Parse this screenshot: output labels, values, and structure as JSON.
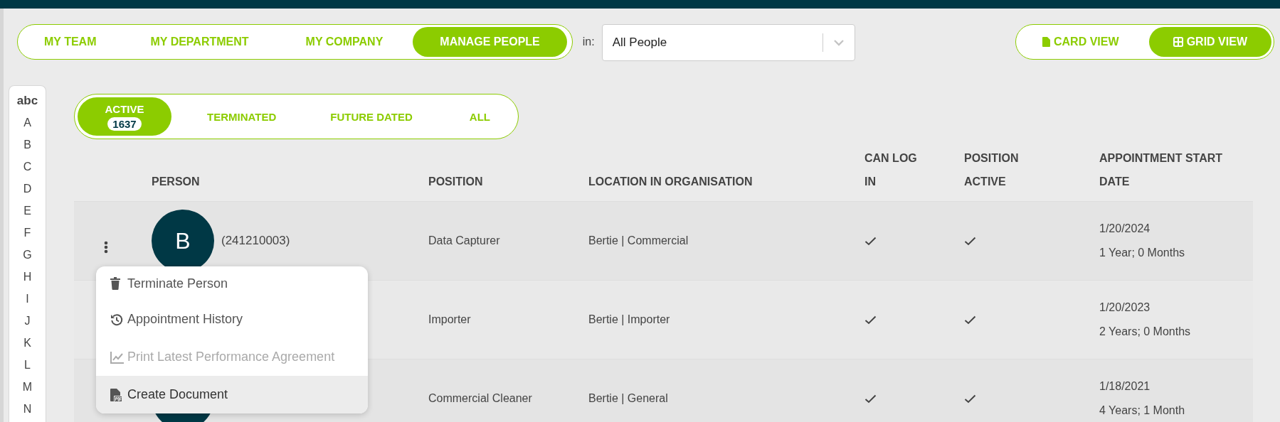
{
  "nav_tabs": [
    {
      "label": "MY TEAM",
      "selected": false
    },
    {
      "label": "MY DEPARTMENT",
      "selected": false
    },
    {
      "label": "MY COMPANY",
      "selected": false
    },
    {
      "label": "MANAGE PEOPLE",
      "selected": true
    }
  ],
  "scope": {
    "label": "in:",
    "value": "All People"
  },
  "view_toggle": [
    {
      "label": "CARD VIEW",
      "kind": "file",
      "selected": false
    },
    {
      "label": "GRID VIEW",
      "kind": "grid",
      "selected": true
    }
  ],
  "alphabet": [
    {
      "label": "abc",
      "selected": true
    },
    {
      "label": "A",
      "selected": false
    },
    {
      "label": "B",
      "selected": false
    },
    {
      "label": "C",
      "selected": false
    },
    {
      "label": "D",
      "selected": false
    },
    {
      "label": "E",
      "selected": false
    },
    {
      "label": "F",
      "selected": false
    },
    {
      "label": "G",
      "selected": false
    },
    {
      "label": "H",
      "selected": false
    },
    {
      "label": "I",
      "selected": false
    },
    {
      "label": "J",
      "selected": false
    },
    {
      "label": "K",
      "selected": false
    },
    {
      "label": "L",
      "selected": false
    },
    {
      "label": "M",
      "selected": false
    },
    {
      "label": "N",
      "selected": false
    }
  ],
  "status_tabs": [
    {
      "label": "ACTIVE",
      "count": "1637",
      "selected": true
    },
    {
      "label": "TERMINATED",
      "selected": false
    },
    {
      "label": "FUTURE DATED",
      "selected": false
    },
    {
      "label": "ALL",
      "selected": false
    }
  ],
  "table": {
    "columns": [
      "PERSON",
      "POSITION",
      "LOCATION IN ORGANISATION",
      "CAN LOG IN",
      "POSITION ACTIVE",
      "APPOINTMENT START DATE"
    ],
    "rows": [
      {
        "avatar": true,
        "avatar_initial": "B",
        "person_id": "(241210003)",
        "position": "Data Capturer",
        "location": "Bertie | Commercial",
        "can_log_in": true,
        "position_active": true,
        "start_date": "1/20/2024",
        "duration": "1 Year; 0 Months"
      },
      {
        "avatar": false,
        "position": "Importer",
        "location": "Bertie | Importer",
        "can_log_in": true,
        "position_active": true,
        "start_date": "1/20/2023",
        "duration": "2 Years; 0 Months"
      },
      {
        "avatar": true,
        "position": "Commercial Cleaner",
        "location": "Bertie | General",
        "can_log_in": true,
        "position_active": true,
        "start_date": "1/18/2021",
        "duration": "4 Years; 1 Month"
      }
    ]
  },
  "row_menu": {
    "items": [
      {
        "label": "Terminate Person",
        "kind": "trash",
        "disabled": false,
        "highlighted": false
      },
      {
        "label": "Appointment History",
        "kind": "history",
        "disabled": false,
        "highlighted": false
      },
      {
        "label": "Print Latest Performance Agreement",
        "kind": "chart",
        "disabled": true,
        "highlighted": false
      },
      {
        "label": "Create Document",
        "kind": "pdf",
        "disabled": false,
        "highlighted": true
      }
    ]
  }
}
